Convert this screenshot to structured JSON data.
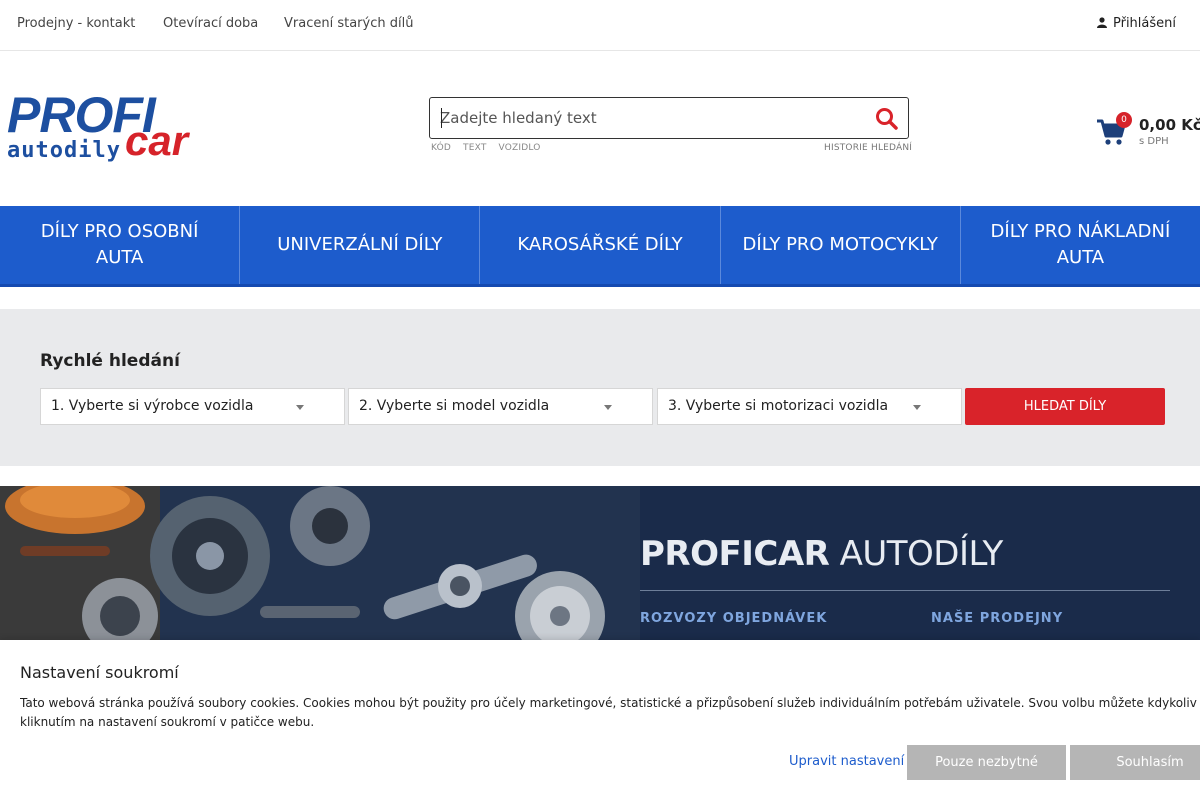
{
  "topbar": {
    "links": [
      "Prodejny - kontakt",
      "Otevírací doba",
      "Vracení starých dílů"
    ],
    "login": "Přihlášení",
    "login_icon": "user-icon"
  },
  "logo": {
    "word1": "PROFI",
    "word2": "autodily",
    "word3": "car"
  },
  "search": {
    "placeholder": "Zadejte hledaný text",
    "hints": [
      "KÓD",
      "TEXT",
      "VOZIDLO"
    ],
    "history": "HISTORIE HLEDÁNÍ",
    "icon": "search-icon"
  },
  "cart": {
    "count": "0",
    "price": "0,00 Kč",
    "note": "s DPH",
    "icon": "cart-icon"
  },
  "nav": {
    "items": [
      "DÍLY PRO OSOBNÍ AUTA",
      "UNIVERZÁLNÍ DÍLY",
      "KAROSÁŘSKÉ DÍLY",
      "DÍLY PRO MOTOCYKLY",
      "DÍLY PRO NÁKLADNÍ AUTA"
    ]
  },
  "quick": {
    "title": "Rychlé hledání",
    "selects": [
      "1. Vyberte si výrobce vozidla",
      "2. Vyberte si model vozidla",
      "3. Vyberte si motorizaci vozidla"
    ],
    "button": "HLEDAT DÍLY"
  },
  "banner": {
    "title_bold": "PROFICAR",
    "title_rest": " AUTODÍLY",
    "sub1": "ROZVOZY OBJEDNÁVEK",
    "sub2": "NAŠE PRODEJNY"
  },
  "cookie": {
    "title": "Nastavení soukromí",
    "text_line1": "Tato webová stránka používá soubory cookies. Cookies mohou být použity pro účely marketingové, statistické a přizpůsobení služeb individuálním potřebám uživatele. Svou volbu můžete kdykoliv změnit",
    "text_line2": "kliknutím na nastavení soukromí v patičce webu.",
    "link": "Upravit nastavení",
    "btn_necessary": "Pouze nezbytné",
    "btn_accept": "Souhlasím"
  },
  "colors": {
    "brand_blue": "#1d5ccc",
    "brand_red": "#d9232a",
    "logo_blue": "#1d4fa0"
  }
}
